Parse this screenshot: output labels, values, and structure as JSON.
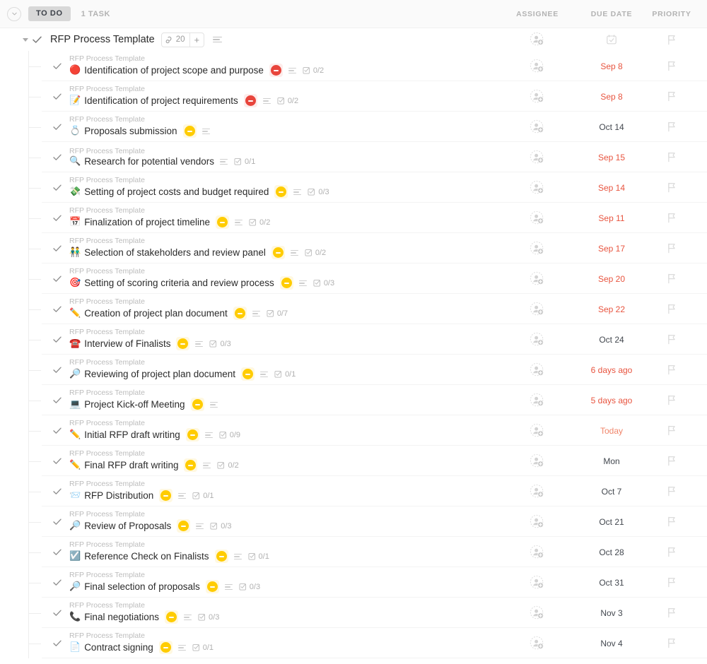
{
  "colors": {
    "overdue": "#e8543f",
    "today": "#f0856a",
    "normal": "#43484f",
    "priority_urgent": "#e8453c",
    "priority_high": "#ffcc00",
    "status_pill_bg": "#d8d8d8",
    "muted": "#b3b3b3"
  },
  "group_header": {
    "collapse_icon": "chevron-down-icon",
    "status_label": "TO DO",
    "task_count": "1 TASK",
    "columns": [
      {
        "label": "ASSIGNEE",
        "key": "assignee"
      },
      {
        "label": "DUE DATE",
        "key": "due_date"
      },
      {
        "label": "PRIORITY",
        "key": "priority"
      }
    ]
  },
  "parent_task": {
    "caret_icon": "caret-down-icon",
    "check_icon": "check-icon",
    "title": "RFP Process Template",
    "subtask_icon": "subtask-link-icon",
    "subtask_count": "20",
    "add_subtask_label": "+",
    "menu_icon": "description-lines-icon",
    "assignee_icon": "add-assignee-icon",
    "due_date_icon": "calendar-icon",
    "priority_icon": "flag-icon"
  },
  "tasks": [
    {
      "breadcrumb": "RFP Process Template",
      "emoji": "🔴",
      "emoji_name": "red-circle-emoji",
      "title": "Identification of project scope and purpose",
      "priority_badge": "urgent",
      "has_description": true,
      "subtask_progress": "0/2",
      "due_date": "Sep 8",
      "due_state": "overdue",
      "priority_flag": "flag-icon"
    },
    {
      "breadcrumb": "RFP Process Template",
      "emoji": "📝",
      "emoji_name": "memo-emoji",
      "title": "Identification of project requirements",
      "priority_badge": "urgent",
      "has_description": true,
      "subtask_progress": "0/2",
      "due_date": "Sep 8",
      "due_state": "overdue",
      "priority_flag": "flag-icon"
    },
    {
      "breadcrumb": "RFP Process Template",
      "emoji": "💍",
      "emoji_name": "ring-emoji",
      "title": "Proposals submission",
      "priority_badge": "high",
      "has_description": true,
      "subtask_progress": "",
      "due_date": "Oct 14",
      "due_state": "normal",
      "priority_flag": "flag-icon"
    },
    {
      "breadcrumb": "RFP Process Template",
      "emoji": "🔍",
      "emoji_name": "magnifying-glass-emoji",
      "title": "Research for potential vendors",
      "priority_badge": "",
      "has_description": true,
      "subtask_progress": "0/1",
      "due_date": "Sep 15",
      "due_state": "overdue",
      "priority_flag": "flag-icon"
    },
    {
      "breadcrumb": "RFP Process Template",
      "emoji": "💸",
      "emoji_name": "money-with-wings-emoji",
      "title": "Setting of project costs and budget required",
      "priority_badge": "high",
      "has_description": true,
      "subtask_progress": "0/3",
      "due_date": "Sep 14",
      "due_state": "overdue",
      "priority_flag": "flag-icon"
    },
    {
      "breadcrumb": "RFP Process Template",
      "emoji": "📅",
      "emoji_name": "calendar-emoji",
      "title": "Finalization of project timeline",
      "priority_badge": "high",
      "has_description": true,
      "subtask_progress": "0/2",
      "due_date": "Sep 11",
      "due_state": "overdue",
      "priority_flag": "flag-icon"
    },
    {
      "breadcrumb": "RFP Process Template",
      "emoji": "👬",
      "emoji_name": "people-emoji",
      "title": "Selection of stakeholders and review panel",
      "priority_badge": "high",
      "has_description": true,
      "subtask_progress": "0/2",
      "due_date": "Sep 17",
      "due_state": "overdue",
      "priority_flag": "flag-icon"
    },
    {
      "breadcrumb": "RFP Process Template",
      "emoji": "🎯",
      "emoji_name": "dart-emoji",
      "title": "Setting of scoring criteria and review process",
      "priority_badge": "high",
      "has_description": true,
      "subtask_progress": "0/3",
      "due_date": "Sep 20",
      "due_state": "overdue",
      "priority_flag": "flag-icon"
    },
    {
      "breadcrumb": "RFP Process Template",
      "emoji": "✏️",
      "emoji_name": "pencil-emoji",
      "title": "Creation of project plan document",
      "priority_badge": "high",
      "has_description": true,
      "subtask_progress": "0/7",
      "due_date": "Sep 22",
      "due_state": "overdue",
      "priority_flag": "flag-icon"
    },
    {
      "breadcrumb": "RFP Process Template",
      "emoji": "☎️",
      "emoji_name": "telephone-emoji",
      "title": "Interview of Finalists",
      "priority_badge": "high",
      "has_description": true,
      "subtask_progress": "0/3",
      "due_date": "Oct 24",
      "due_state": "normal",
      "priority_flag": "flag-icon"
    },
    {
      "breadcrumb": "RFP Process Template",
      "emoji": "🔎",
      "emoji_name": "magnifying-glass-right-emoji",
      "title": "Reviewing of project plan document",
      "priority_badge": "high",
      "has_description": true,
      "subtask_progress": "0/1",
      "due_date": "6 days ago",
      "due_state": "overdue",
      "priority_flag": "flag-icon"
    },
    {
      "breadcrumb": "RFP Process Template",
      "emoji": "💻",
      "emoji_name": "laptop-emoji",
      "title": "Project Kick-off Meeting",
      "priority_badge": "high",
      "has_description": true,
      "subtask_progress": "",
      "due_date": "5 days ago",
      "due_state": "overdue",
      "priority_flag": "flag-icon"
    },
    {
      "breadcrumb": "RFP Process Template",
      "emoji": "✏️",
      "emoji_name": "pencil-emoji",
      "title": "Initial RFP draft writing",
      "priority_badge": "high",
      "has_description": true,
      "subtask_progress": "0/9",
      "due_date": "Today",
      "due_state": "today",
      "priority_flag": "flag-icon"
    },
    {
      "breadcrumb": "RFP Process Template",
      "emoji": "✏️",
      "emoji_name": "pencil-emoji",
      "title": "Final RFP draft writing",
      "priority_badge": "high",
      "has_description": true,
      "subtask_progress": "0/2",
      "due_date": "Mon",
      "due_state": "normal",
      "priority_flag": "flag-icon"
    },
    {
      "breadcrumb": "RFP Process Template",
      "emoji": "📨",
      "emoji_name": "incoming-envelope-emoji",
      "title": "RFP Distribution",
      "priority_badge": "high",
      "has_description": true,
      "subtask_progress": "0/1",
      "due_date": "Oct 7",
      "due_state": "normal",
      "priority_flag": "flag-icon"
    },
    {
      "breadcrumb": "RFP Process Template",
      "emoji": "🔎",
      "emoji_name": "magnifying-glass-right-emoji",
      "title": "Review of Proposals",
      "priority_badge": "high",
      "has_description": true,
      "subtask_progress": "0/3",
      "due_date": "Oct 21",
      "due_state": "normal",
      "priority_flag": "flag-icon"
    },
    {
      "breadcrumb": "RFP Process Template",
      "emoji": "☑️",
      "emoji_name": "ballot-box-check-emoji",
      "title": "Reference Check on Finalists",
      "priority_badge": "high",
      "has_description": true,
      "subtask_progress": "0/1",
      "due_date": "Oct 28",
      "due_state": "normal",
      "priority_flag": "flag-icon"
    },
    {
      "breadcrumb": "RFP Process Template",
      "emoji": "🔎",
      "emoji_name": "magnifying-glass-right-emoji",
      "title": "Final selection of proposals",
      "priority_badge": "high",
      "has_description": true,
      "subtask_progress": "0/3",
      "due_date": "Oct 31",
      "due_state": "normal",
      "priority_flag": "flag-icon"
    },
    {
      "breadcrumb": "RFP Process Template",
      "emoji": "📞",
      "emoji_name": "telephone-receiver-emoji",
      "title": "Final negotiations",
      "priority_badge": "high",
      "has_description": true,
      "subtask_progress": "0/3",
      "due_date": "Nov 3",
      "due_state": "normal",
      "priority_flag": "flag-icon"
    },
    {
      "breadcrumb": "RFP Process Template",
      "emoji": "📄",
      "emoji_name": "page-facing-up-emoji",
      "title": "Contract signing",
      "priority_badge": "high",
      "has_description": true,
      "subtask_progress": "0/1",
      "due_date": "Nov 4",
      "due_state": "normal",
      "priority_flag": "flag-icon"
    }
  ]
}
